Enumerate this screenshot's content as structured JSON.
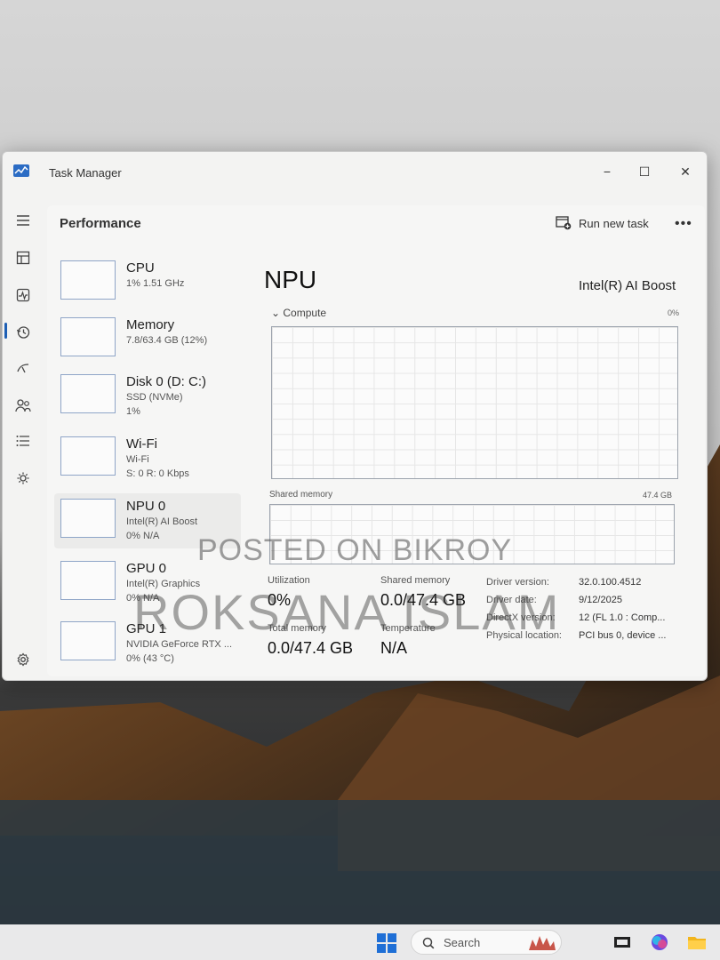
{
  "window": {
    "title": "Task Manager",
    "minimize_glyph": "−",
    "maximize_glyph": "☐",
    "close_glyph": "✕"
  },
  "nav": {
    "items": [
      "menu-icon",
      "processes-icon",
      "performance-icon",
      "app-history-icon",
      "startup-apps-icon",
      "users-icon",
      "details-icon",
      "services-icon",
      "settings-icon"
    ],
    "active": "performance-icon"
  },
  "header": {
    "page_title": "Performance",
    "run_new_task": "Run new task",
    "more": "•••"
  },
  "devices": [
    {
      "name": "CPU",
      "line1": "1%  1.51 GHz",
      "line2": ""
    },
    {
      "name": "Memory",
      "line1": "7.8/63.4 GB (12%)",
      "line2": ""
    },
    {
      "name": "Disk 0 (D: C:)",
      "line1": "SSD (NVMe)",
      "line2": "1%"
    },
    {
      "name": "Wi-Fi",
      "line1": "Wi-Fi",
      "line2": "S: 0 R: 0 Kbps"
    },
    {
      "name": "NPU 0",
      "line1": "Intel(R) AI Boost",
      "line2": "0%  N/A"
    },
    {
      "name": "GPU 0",
      "line1": "Intel(R) Graphics",
      "line2": "0%  N/A"
    },
    {
      "name": "GPU 1",
      "line1": "NVIDIA GeForce RTX ...",
      "line2": "0%  (43 °C)"
    }
  ],
  "selected_device": "NPU 0",
  "detail": {
    "title": "NPU",
    "device_name": "Intel(R) AI Boost",
    "compute_label": "Compute",
    "compute_pct": "0%",
    "shared_memory_label": "Shared memory",
    "shared_memory_size": "47.4 GB",
    "stats": {
      "utilization_label": "Utilization",
      "utilization_value": "0%",
      "shared_memory_label": "Shared memory",
      "shared_memory_value": "0.0/47.4 GB",
      "total_memory_label": "Total memory",
      "total_memory_value": "0.0/47.4 GB",
      "temperature_label": "Temperature",
      "temperature_value": "N/A"
    },
    "properties": {
      "driver_version_label": "Driver version:",
      "driver_version_value": "32.0.100.4512",
      "driver_date_label": "Driver date:",
      "driver_date_value": "9/12/2025",
      "directx_label": "DirectX version:",
      "directx_value": "12 (FL 1.0 : Comp...",
      "physical_location_label": "Physical location:",
      "physical_location_value": "PCI bus 0, device ..."
    }
  },
  "watermarks": {
    "line1": "POSTED ON BIKROY",
    "line2": "ROKSANA ISLAM"
  },
  "taskbar": {
    "search_placeholder": "Search"
  },
  "colors": {
    "accent": "#1e5fb4",
    "graph_border": "#9ca3ad",
    "thumb_border": "#8ea5c7"
  }
}
